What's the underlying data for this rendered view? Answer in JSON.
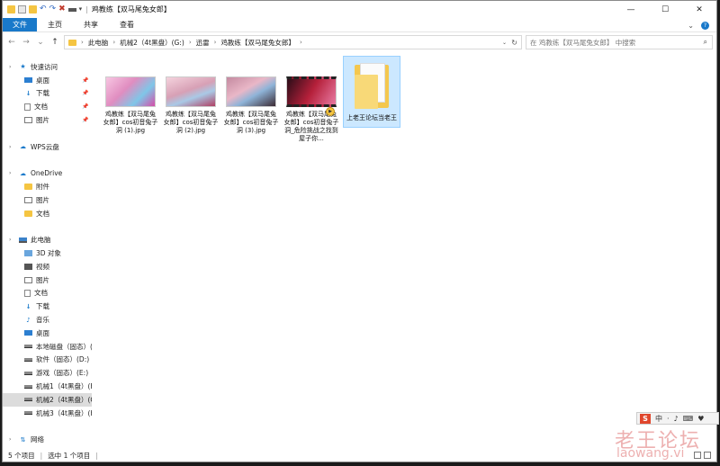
{
  "window": {
    "title": "鸡教练【双马尾兔女郎】",
    "controls": {
      "minimize": "—",
      "maximize": "☐",
      "close": "✕"
    }
  },
  "ribbon": {
    "tabs": [
      "文件",
      "主页",
      "共享",
      "查看"
    ],
    "expand": "⌄",
    "help": "?"
  },
  "address": {
    "crumbs": [
      "此电脑",
      "机械2（4t黑盘）(G:)",
      "迅雷",
      "鸡教练【双马尾兔女郎】"
    ],
    "search_placeholder": "在 鸡教练【双马尾兔女郎】 中搜索"
  },
  "sidebar": {
    "items": [
      {
        "label": "快速访问",
        "icon": "star-icon",
        "pin": false,
        "level": 0
      },
      {
        "label": "桌面",
        "icon": "desktop-icon",
        "pin": true,
        "level": 1
      },
      {
        "label": "下载",
        "icon": "download-icon",
        "pin": true,
        "level": 1
      },
      {
        "label": "文档",
        "icon": "document-icon",
        "pin": true,
        "level": 1
      },
      {
        "label": "图片",
        "icon": "picture-icon",
        "pin": true,
        "level": 1
      },
      {
        "label": "",
        "icon": "",
        "pin": false,
        "level": 1
      },
      {
        "label": "WPS云盘",
        "icon": "cloud-icon",
        "pin": false,
        "level": 0
      },
      {
        "label": "",
        "icon": "",
        "pin": false,
        "level": 1
      },
      {
        "label": "OneDrive",
        "icon": "cloud-icon",
        "pin": false,
        "level": 0
      },
      {
        "label": "附件",
        "icon": "folder-icon",
        "pin": false,
        "level": 1
      },
      {
        "label": "图片",
        "icon": "picture-icon",
        "pin": false,
        "level": 1
      },
      {
        "label": "文档",
        "icon": "folder-icon",
        "pin": false,
        "level": 1
      },
      {
        "label": "",
        "icon": "",
        "pin": false,
        "level": 1
      },
      {
        "label": "此电脑",
        "icon": "pc-icon",
        "pin": false,
        "level": 0
      },
      {
        "label": "3D 对象",
        "icon": "3d-icon",
        "pin": false,
        "level": 1
      },
      {
        "label": "视频",
        "icon": "video-icon",
        "pin": false,
        "level": 1
      },
      {
        "label": "图片",
        "icon": "picture-icon",
        "pin": false,
        "level": 1
      },
      {
        "label": "文档",
        "icon": "document-icon",
        "pin": false,
        "level": 1
      },
      {
        "label": "下载",
        "icon": "download-icon",
        "pin": false,
        "level": 1
      },
      {
        "label": "音乐",
        "icon": "music-icon",
        "pin": false,
        "level": 1
      },
      {
        "label": "桌面",
        "icon": "desktop-icon",
        "pin": false,
        "level": 1
      },
      {
        "label": "本地磁盘（固态）(",
        "icon": "drive-icon",
        "pin": false,
        "level": 1
      },
      {
        "label": "软件（固态）(D:)",
        "icon": "drive-icon",
        "pin": false,
        "level": 1
      },
      {
        "label": "游戏（固态）(E:)",
        "icon": "drive-icon",
        "pin": false,
        "level": 1
      },
      {
        "label": "机械1（4t黑盘）(F",
        "icon": "drive-icon",
        "pin": false,
        "level": 1
      },
      {
        "label": "机械2（4t黑盘）(G",
        "icon": "drive-icon",
        "pin": false,
        "level": 1,
        "selected": true
      },
      {
        "label": "机械3（4t黑盘）(H",
        "icon": "drive-icon",
        "pin": false,
        "level": 1
      },
      {
        "label": "",
        "icon": "",
        "pin": false,
        "level": 1
      },
      {
        "label": "网络",
        "icon": "network-icon",
        "pin": false,
        "level": 0
      }
    ]
  },
  "files": [
    {
      "name": "鸡教练【双马尾兔女郎】cos初音兔子洞 (1).jpg",
      "kind": "image",
      "selected": false
    },
    {
      "name": "鸡教练【双马尾兔女郎】cos初音兔子洞 (2).jpg",
      "kind": "image",
      "selected": false
    },
    {
      "name": "鸡教练【双马尾兔女郎】cos初音兔子洞 (3).jpg",
      "kind": "image",
      "selected": false
    },
    {
      "name": "鸡教练【双马尾兔女郎】cos初音兔子洞_危险挑战之找到屋子你...",
      "kind": "video",
      "selected": false
    },
    {
      "name": "上老王论坛当老王",
      "kind": "folder",
      "selected": true
    }
  ],
  "status": {
    "count": "5 个项目",
    "selection": "选中 1 个项目"
  },
  "ime": {
    "logo": "S",
    "items": [
      "中",
      "·",
      "♪",
      "⌨",
      "♥"
    ]
  },
  "watermark": {
    "line1": "老王论坛",
    "line2": "laowang.vi"
  }
}
